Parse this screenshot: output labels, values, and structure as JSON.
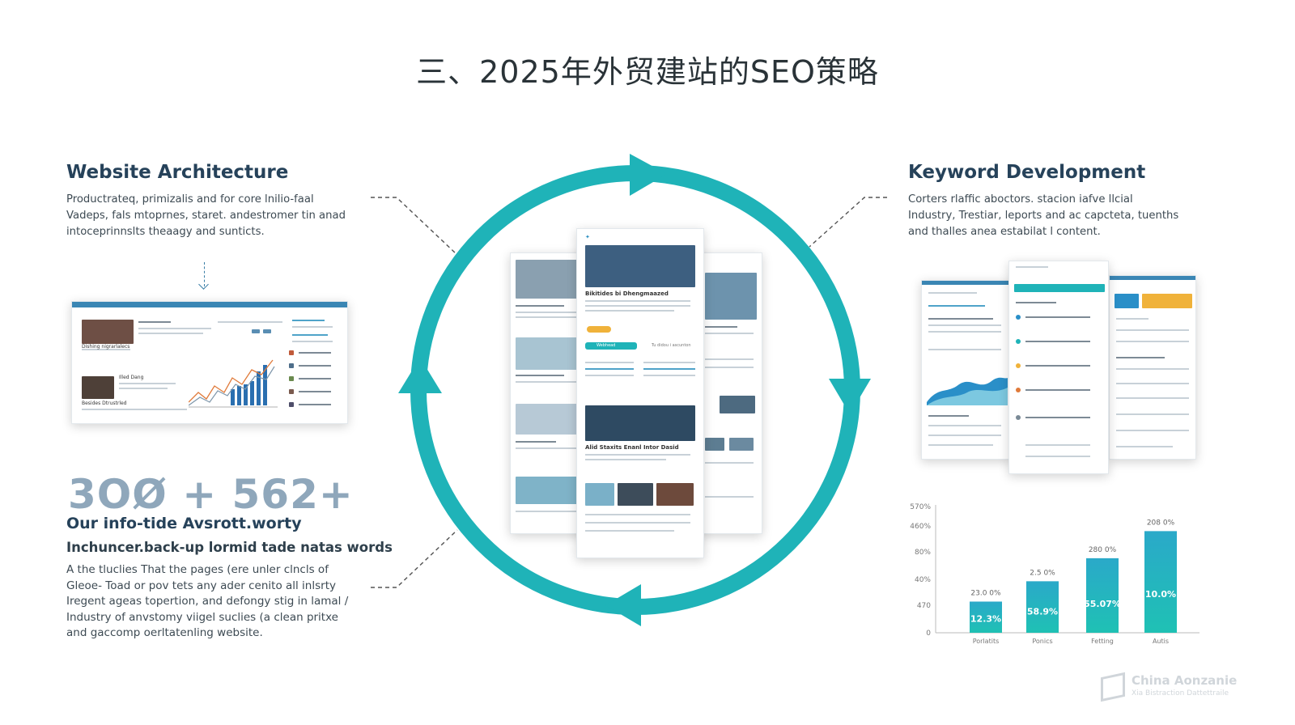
{
  "title": "三、2025年外贸建站的SEO策略",
  "left": {
    "heading": "Website Architecture",
    "paragraph": [
      "Productrateq, primizalis and for core lnilio-faal",
      "Vadeps, fals mtoprnes, staret. andestromer tin anad",
      "intoceprinnslts theaagy and sunticts."
    ],
    "big_number": "3OØ + 562+",
    "subheading": "Our info-tide Avsrott.worty",
    "subheading2": "Inchuncer.back-up lormid tade natas words",
    "body": [
      "A the tluclies  That the pages (ere unler clncls of",
      "Gleoe- Toad or pov tets any ader cenito all inlsrty",
      "Iregent ageas topertion, and defongy stig in lamal /",
      "Industry of anvstomy viigel suclies (a clean pritxe",
      "and gaccomp oerltatenling website."
    ]
  },
  "right": {
    "heading": "Keyword Development",
    "paragraph": [
      "Corters rlaffic aboctors. stacion iafve llcial",
      "Industry, Trestiar, leports and ac capcteta, tuenths",
      "and thalles anea estabilat l content."
    ]
  },
  "chart_data": {
    "type": "bar",
    "categories": [
      "Porlatits",
      "Ponics",
      "Fetting",
      "Autis"
    ],
    "values": [
      12.3,
      58.9,
      55.07,
      10.0
    ],
    "bar_labels": [
      "12.3%",
      "58.9%",
      "55.07%",
      "10.0%"
    ],
    "top_labels": [
      "23.0 0%",
      "2.5 0%",
      "280 0%",
      "208 0%"
    ],
    "heights": [
      23,
      38,
      55,
      75
    ],
    "ylabels": [
      "570%",
      "460%",
      "80%",
      "40%",
      "470",
      "0"
    ],
    "colors": {
      "bar_top": "#2aa9c9",
      "bar_bottom": "#1fc1b4"
    }
  },
  "colors": {
    "ring": "#1fb3b8",
    "heading": "#26425a"
  },
  "watermark": {
    "line1": "China Aonzanie",
    "line2": "Xia Bistraction Dattettraile"
  },
  "mock_left": {
    "label1": "Dishing nigrarlalecs",
    "label2": "Illed Dang",
    "label3": "Besides Dtrustrled"
  },
  "mock_center": {
    "headline1": "Bikitides bi Dhengmaazed",
    "headline2": "Alid Staxits Enanl Intor Dasid",
    "tab_active": "Webhead",
    "tab_other": "Tu didou i ascunton"
  }
}
